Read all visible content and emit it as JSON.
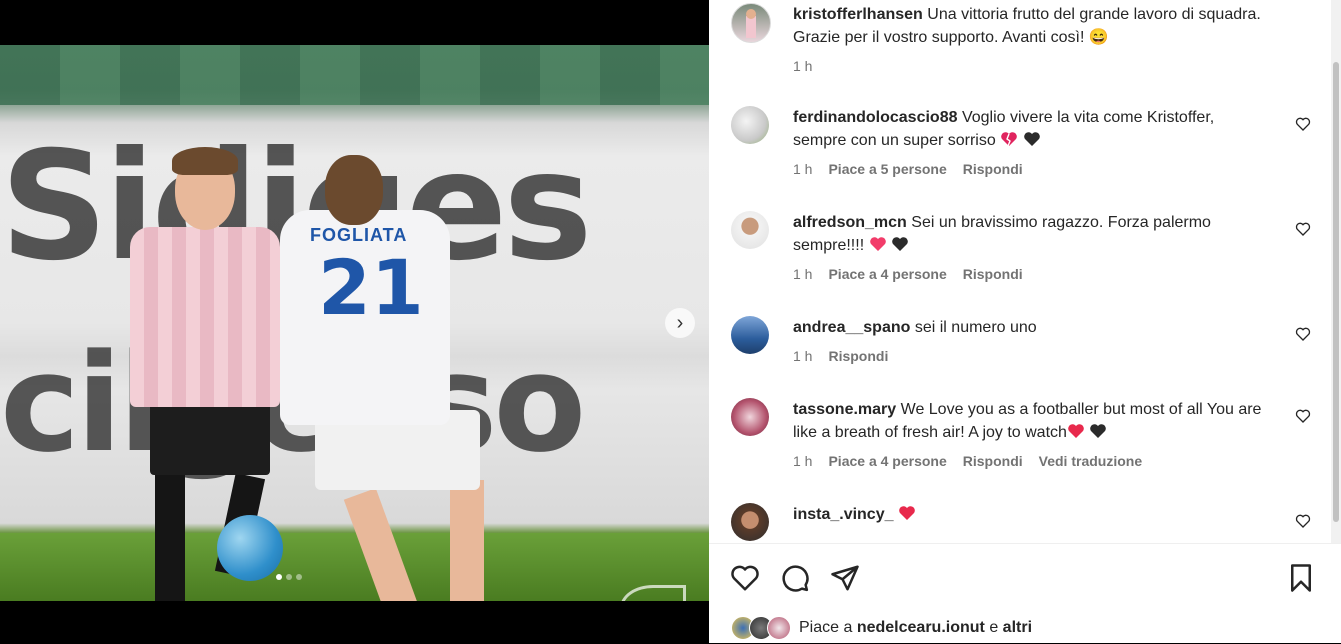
{
  "post": {
    "author": "kristofferlhansen",
    "caption": "Una vittoria frutto del grande lavoro di squadra. Grazie per il vostro supporto. Avanti così! 😄",
    "time": "1 h"
  },
  "photo": {
    "ad_text_1": "Sidiges",
    "ad_text_2": "cilgesso",
    "player_name": "FOGLIATA",
    "player_number": "21",
    "carousel_index": 1,
    "carousel_count": 3
  },
  "comments": [
    {
      "user": "ferdinandolocascio88",
      "text": "Voglio vivere la vita come Kristoffer, sempre con un super sorriso",
      "hearts": [
        "red-broken",
        "black"
      ],
      "time": "1 h",
      "likes": "Piace a 5 persone",
      "reply": "Rispondi"
    },
    {
      "user": "alfredson_mcn",
      "text": "Sei un bravissimo ragazzo. Forza palermo sempre!!!!",
      "hearts": [
        "pink",
        "black"
      ],
      "time": "1 h",
      "likes": "Piace a 4 persone",
      "reply": "Rispondi"
    },
    {
      "user": "andrea__spano",
      "text": "sei il numero uno",
      "hearts": [],
      "time": "1 h",
      "likes": "",
      "reply": "Rispondi"
    },
    {
      "user": "tassone.mary",
      "text": "We Love you as a footballer but most of all You are like a breath of fresh air! A joy to watch",
      "hearts": [
        "red",
        "black"
      ],
      "time": "1 h",
      "likes": "Piace a 4 persone",
      "reply": "Rispondi",
      "translate": "Vedi traduzione"
    },
    {
      "user": "insta_.vincy_",
      "text": "",
      "hearts": [
        "red"
      ],
      "time": "",
      "likes": "",
      "reply": ""
    }
  ],
  "actions": {
    "like_icon": "heart-outline-icon",
    "comment_icon": "comment-bubble-icon",
    "share_icon": "paper-plane-icon",
    "save_icon": "bookmark-icon"
  },
  "likes_summary": {
    "prefix": "Piace a",
    "user": "nedelcearu.ionut",
    "conjunction": "e",
    "others": "altri"
  },
  "colors": {
    "text": "#262626",
    "secondary": "#737373",
    "heart_red": "#ed4956",
    "accent_blue": "#1f56a8"
  }
}
